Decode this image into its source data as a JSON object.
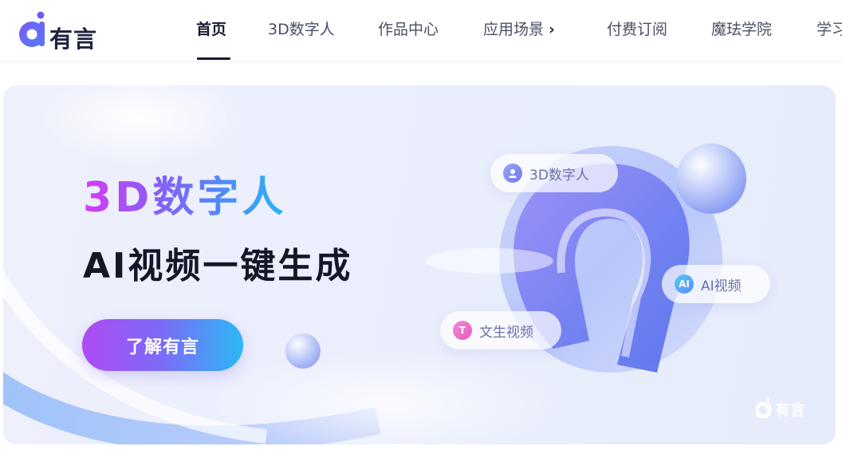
{
  "logo": {
    "text": "有言",
    "icon": "logo-a-icon"
  },
  "nav": {
    "items": [
      {
        "label": "首页",
        "active": true
      },
      {
        "label": "3D数字人"
      },
      {
        "label": "作品中心"
      },
      {
        "label": "应用场景",
        "icon": "chevron-right-icon"
      },
      {
        "label": "付费订阅"
      },
      {
        "label": "魔珐学院"
      },
      {
        "label": "学习"
      }
    ]
  },
  "banner": {
    "headline": "3D数字人",
    "subline": "AI视频一键生成",
    "cta_label": "了解有言",
    "tags": [
      {
        "label": "3D数字人",
        "icon": "avatar-icon"
      },
      {
        "label": "AI视频",
        "icon_text": "AI"
      },
      {
        "label": "文生视频",
        "icon_text": "T"
      }
    ],
    "watermark": "有言",
    "colors": {
      "headline_gradient": [
        "#d53cf5",
        "#8b5cf6",
        "#4d8cf7",
        "#2ab4f5"
      ],
      "cta_gradient": [
        "#b04bf3",
        "#7a6cf7",
        "#2bb8f4"
      ]
    }
  }
}
